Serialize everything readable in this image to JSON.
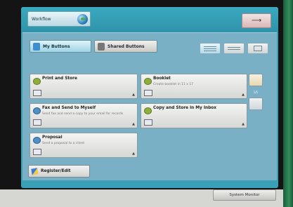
{
  "colors": {
    "screen": "#3aa0b8",
    "panel": "#7ab0c6",
    "card_icon_green": "#8fae3a"
  },
  "header": {
    "workflow_label": "Workflow",
    "logout_symbol": "⟶"
  },
  "tabs": {
    "my_buttons": "My Buttons",
    "shared_buttons": "Shared Buttons"
  },
  "cards": [
    {
      "title": "Print and Store",
      "description": ""
    },
    {
      "title": "Booklet",
      "description": "Create booklet in 11 x 17"
    },
    {
      "title": "Fax and Send to Myself",
      "description": "Send fax and send a copy to your email for records"
    },
    {
      "title": "Copy and Store in My Inbox",
      "description": ""
    },
    {
      "title": "Proposal",
      "description": "Send a proposal to a client"
    }
  ],
  "pagination": {
    "label": "1/1"
  },
  "footer": {
    "register_edit": "Register/Edit",
    "system_monitor": "System Monitor"
  }
}
